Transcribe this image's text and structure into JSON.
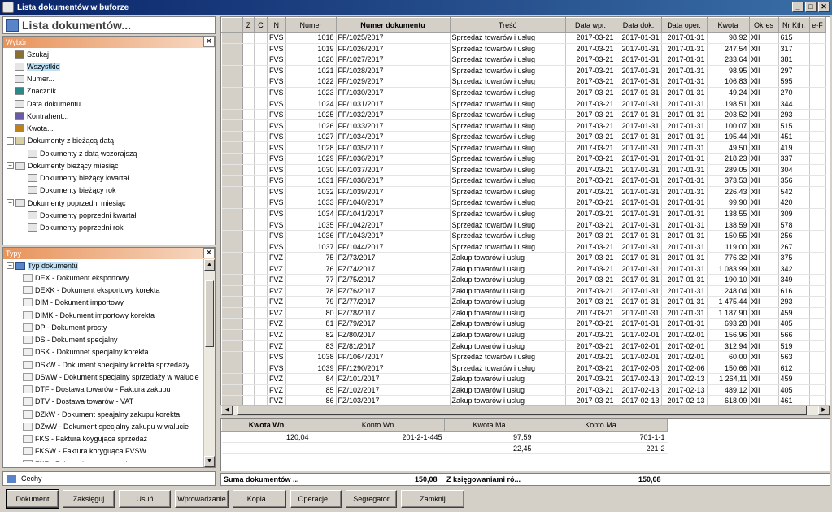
{
  "window": {
    "title": "Lista dokumentów w buforze",
    "btn_min": "_",
    "btn_max": "□",
    "btn_close": "✕"
  },
  "header": {
    "title": "Lista dokumentów..."
  },
  "wybor": {
    "title": "Wybór",
    "close": "✕",
    "items": [
      {
        "label": "Szukaj",
        "indent": 0,
        "icon": "search-icon",
        "exp": ""
      },
      {
        "label": "Wszystkie",
        "indent": 0,
        "icon": "list-icon",
        "exp": "",
        "selected": true
      },
      {
        "label": "Numer...",
        "indent": 0,
        "icon": "list-icon",
        "exp": ""
      },
      {
        "label": "Znacznik...",
        "indent": 0,
        "icon": "marker-icon",
        "exp": ""
      },
      {
        "label": "Data dokumentu...",
        "indent": 0,
        "icon": "list-icon",
        "exp": ""
      },
      {
        "label": "Kontrahent...",
        "indent": 0,
        "icon": "contractor-icon",
        "exp": ""
      },
      {
        "label": "Kwota...",
        "indent": 0,
        "icon": "money-icon",
        "exp": ""
      },
      {
        "label": "Dokumenty z bieżącą datą",
        "indent": 0,
        "icon": "calendar-icon",
        "exp": "−"
      },
      {
        "label": "Dokumenty z datą wczorajszą",
        "indent": 1,
        "icon": "list-icon",
        "exp": ""
      },
      {
        "label": "Dokumenty bieżący miesiąc",
        "indent": 0,
        "icon": "list-icon",
        "exp": "−"
      },
      {
        "label": "Dokumenty bieżący kwartał",
        "indent": 1,
        "icon": "list-icon",
        "exp": ""
      },
      {
        "label": "Dokumenty bieżący rok",
        "indent": 1,
        "icon": "list-icon",
        "exp": ""
      },
      {
        "label": "Dokumenty poprzedni miesiąc",
        "indent": 0,
        "icon": "list-icon",
        "exp": "−"
      },
      {
        "label": "Dokumenty poprzedni kwartał",
        "indent": 1,
        "icon": "list-icon",
        "exp": ""
      },
      {
        "label": "Dokumenty poprzedni rok",
        "indent": 1,
        "icon": "list-icon",
        "exp": ""
      }
    ]
  },
  "typy": {
    "title": "Typy",
    "close": "✕",
    "root": "Typ dokumentu",
    "root_exp": "−",
    "items": [
      "DEX - Dokument eksportowy",
      "DEXK - Dokument eksportowy korekta",
      "DIM - Dokument importowy",
      "DIMK - Dokument importowy korekta",
      "DP - Dokument prosty",
      "DS - Dokument specjalny",
      "DSK - Dokumnet specjalny korekta",
      "DSkW - Dokument specjalny korekta sprzedaży",
      "DSwW - Dokument specjalny sprzedaży w walucie",
      "DTF - Dostawa towarów - Faktura zakupu",
      "DTV - Dostawa towarów - VAT",
      "DZkW - Dokument speajalny zakupu korekta",
      "DZwW - Dokument specjalny zakupu w walucie",
      "FKS - Faktura koygująca sprzedaż",
      "FKSW - Faktura koryguąca FVSW",
      "FKZ - Faktura koryguąca zakup"
    ]
  },
  "cechy": {
    "label": "Cechy"
  },
  "grid": {
    "columns": [
      "Z",
      "C",
      "N",
      "Numer",
      "Numer dokumentu",
      "Treść",
      "Data wpr.",
      "Data dok.",
      "Data oper.",
      "Kwota",
      "Okres",
      "Nr Kth.",
      "e-F"
    ],
    "rows": [
      [
        "FVS",
        "1018",
        "FF/1025/2017",
        "Sprzedaż towarów i usług",
        "2017-03-21",
        "2017-01-31",
        "2017-01-31",
        "98,92",
        "XII",
        "615"
      ],
      [
        "FVS",
        "1019",
        "FF/1026/2017",
        "Sprzedaż towarów i usług",
        "2017-03-21",
        "2017-01-31",
        "2017-01-31",
        "247,54",
        "XII",
        "317"
      ],
      [
        "FVS",
        "1020",
        "FF/1027/2017",
        "Sprzedaż towarów i usług",
        "2017-03-21",
        "2017-01-31",
        "2017-01-31",
        "233,64",
        "XII",
        "381"
      ],
      [
        "FVS",
        "1021",
        "FF/1028/2017",
        "Sprzedaż towarów i usług",
        "2017-03-21",
        "2017-01-31",
        "2017-01-31",
        "98,95",
        "XII",
        "297"
      ],
      [
        "FVS",
        "1022",
        "FF/1029/2017",
        "Sprzedaż towarów i usług",
        "2017-03-21",
        "2017-01-31",
        "2017-01-31",
        "106,83",
        "XII",
        "595"
      ],
      [
        "FVS",
        "1023",
        "FF/1030/2017",
        "Sprzedaż towarów i usług",
        "2017-03-21",
        "2017-01-31",
        "2017-01-31",
        "49,24",
        "XII",
        "270"
      ],
      [
        "FVS",
        "1024",
        "FF/1031/2017",
        "Sprzedaż towarów i usług",
        "2017-03-21",
        "2017-01-31",
        "2017-01-31",
        "198,51",
        "XII",
        "344"
      ],
      [
        "FVS",
        "1025",
        "FF/1032/2017",
        "Sprzedaż towarów i usług",
        "2017-03-21",
        "2017-01-31",
        "2017-01-31",
        "203,52",
        "XII",
        "293"
      ],
      [
        "FVS",
        "1026",
        "FF/1033/2017",
        "Sprzedaż towarów i usług",
        "2017-03-21",
        "2017-01-31",
        "2017-01-31",
        "100,07",
        "XII",
        "515"
      ],
      [
        "FVS",
        "1027",
        "FF/1034/2017",
        "Sprzedaż towarów i usług",
        "2017-03-21",
        "2017-01-31",
        "2017-01-31",
        "195,44",
        "XII",
        "451"
      ],
      [
        "FVS",
        "1028",
        "FF/1035/2017",
        "Sprzedaż towarów i usług",
        "2017-03-21",
        "2017-01-31",
        "2017-01-31",
        "49,50",
        "XII",
        "419"
      ],
      [
        "FVS",
        "1029",
        "FF/1036/2017",
        "Sprzedaż towarów i usług",
        "2017-03-21",
        "2017-01-31",
        "2017-01-31",
        "218,23",
        "XII",
        "337"
      ],
      [
        "FVS",
        "1030",
        "FF/1037/2017",
        "Sprzedaż towarów i usług",
        "2017-03-21",
        "2017-01-31",
        "2017-01-31",
        "289,05",
        "XII",
        "304"
      ],
      [
        "FVS",
        "1031",
        "FF/1038/2017",
        "Sprzedaż towarów i usług",
        "2017-03-21",
        "2017-01-31",
        "2017-01-31",
        "373,53",
        "XII",
        "356"
      ],
      [
        "FVS",
        "1032",
        "FF/1039/2017",
        "Sprzedaż towarów i usług",
        "2017-03-21",
        "2017-01-31",
        "2017-01-31",
        "226,43",
        "XII",
        "542"
      ],
      [
        "FVS",
        "1033",
        "FF/1040/2017",
        "Sprzedaż towarów i usług",
        "2017-03-21",
        "2017-01-31",
        "2017-01-31",
        "99,90",
        "XII",
        "420"
      ],
      [
        "FVS",
        "1034",
        "FF/1041/2017",
        "Sprzedaż towarów i usług",
        "2017-03-21",
        "2017-01-31",
        "2017-01-31",
        "138,55",
        "XII",
        "309"
      ],
      [
        "FVS",
        "1035",
        "FF/1042/2017",
        "Sprzedaż towarów i usług",
        "2017-03-21",
        "2017-01-31",
        "2017-01-31",
        "138,59",
        "XII",
        "578"
      ],
      [
        "FVS",
        "1036",
        "FF/1043/2017",
        "Sprzedaż towarów i usług",
        "2017-03-21",
        "2017-01-31",
        "2017-01-31",
        "150,55",
        "XII",
        "256"
      ],
      [
        "FVS",
        "1037",
        "FF/1044/2017",
        "Sprzedaż towarów i usług",
        "2017-03-21",
        "2017-01-31",
        "2017-01-31",
        "119,00",
        "XII",
        "267"
      ],
      [
        "FVZ",
        "75",
        "FZ/73/2017",
        "Zakup towarów i usług",
        "2017-03-21",
        "2017-01-31",
        "2017-01-31",
        "776,32",
        "XII",
        "375"
      ],
      [
        "FVZ",
        "76",
        "FZ/74/2017",
        "Zakup towarów i usług",
        "2017-03-21",
        "2017-01-31",
        "2017-01-31",
        "1 083,99",
        "XII",
        "342"
      ],
      [
        "FVZ",
        "77",
        "FZ/75/2017",
        "Zakup towarów i usług",
        "2017-03-21",
        "2017-01-31",
        "2017-01-31",
        "190,10",
        "XII",
        "349"
      ],
      [
        "FVZ",
        "78",
        "FZ/76/2017",
        "Zakup towarów i usług",
        "2017-03-21",
        "2017-01-31",
        "2017-01-31",
        "248,04",
        "XII",
        "616"
      ],
      [
        "FVZ",
        "79",
        "FZ/77/2017",
        "Zakup towarów i usług",
        "2017-03-21",
        "2017-01-31",
        "2017-01-31",
        "1 475,44",
        "XII",
        "293"
      ],
      [
        "FVZ",
        "80",
        "FZ/78/2017",
        "Zakup towarów i usług",
        "2017-03-21",
        "2017-01-31",
        "2017-01-31",
        "1 187,90",
        "XII",
        "459"
      ],
      [
        "FVZ",
        "81",
        "FZ/79/2017",
        "Zakup towarów i usług",
        "2017-03-21",
        "2017-01-31",
        "2017-01-31",
        "693,28",
        "XII",
        "405"
      ],
      [
        "FVZ",
        "82",
        "FZ/80/2017",
        "Zakup towarów i usług",
        "2017-03-21",
        "2017-02-01",
        "2017-02-01",
        "156,96",
        "XII",
        "566"
      ],
      [
        "FVZ",
        "83",
        "FZ/81/2017",
        "Zakup towarów i usług",
        "2017-03-21",
        "2017-02-01",
        "2017-02-01",
        "312,94",
        "XII",
        "519"
      ],
      [
        "FVS",
        "1038",
        "FF/1064/2017",
        "Sprzedaż towarów i usług",
        "2017-03-21",
        "2017-02-01",
        "2017-02-01",
        "60,00",
        "XII",
        "563"
      ],
      [
        "FVS",
        "1039",
        "FF/1290/2017",
        "Sprzedaż towarów i usług",
        "2017-03-21",
        "2017-02-06",
        "2017-02-06",
        "150,66",
        "XII",
        "612"
      ],
      [
        "FVZ",
        "84",
        "FZ/101/2017",
        "Zakup towarów i usług",
        "2017-03-21",
        "2017-02-13",
        "2017-02-13",
        "1 264,11",
        "XII",
        "459"
      ],
      [
        "FVZ",
        "85",
        "FZ/102/2017",
        "Zakup towarów i usług",
        "2017-03-21",
        "2017-02-13",
        "2017-02-13",
        "489,12",
        "XII",
        "405"
      ],
      [
        "FVZ",
        "86",
        "FZ/103/2017",
        "Zakup towarów i usług",
        "2017-03-21",
        "2017-02-13",
        "2017-02-13",
        "618,09",
        "XII",
        "461"
      ]
    ]
  },
  "accounts": {
    "columns": [
      "Kwota Wn",
      "Konto Wn",
      "Kwota Ma",
      "Konto Ma"
    ],
    "rows": [
      [
        "120,04",
        "201-2-1-445",
        "97,59",
        "701-1-1"
      ],
      [
        "",
        "",
        "22,45",
        "221-2"
      ]
    ]
  },
  "summary": {
    "label1": "Suma dokumentów ...",
    "value1": "150,08",
    "label2": "Z księgowaniami ró...",
    "value2": "150,08"
  },
  "buttons": [
    "Dokument",
    "Zaksięguj",
    "Usuń",
    "Wprowadzanie",
    "Kopia...",
    "Operacje...",
    "Segregator",
    "Zamknij"
  ],
  "colors": {
    "title_bar": "#0a246a",
    "panel_header": "#e8935a",
    "selection": "#bde0f5",
    "window_bg": "#d4d0c8"
  }
}
